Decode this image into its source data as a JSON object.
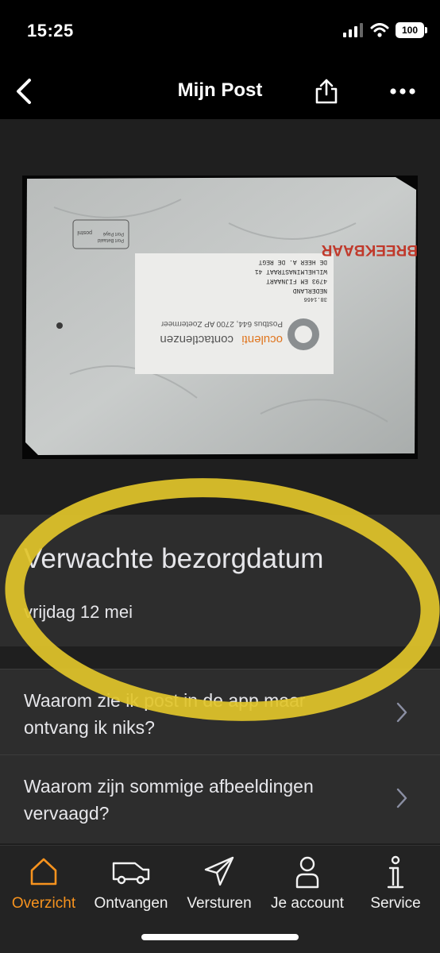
{
  "status_bar": {
    "time": "15:25",
    "battery": "100"
  },
  "nav": {
    "title": "Mijn Post"
  },
  "envelope": {
    "sender_brand": "oculenti",
    "sender_brand_suffix": "contactlenzen",
    "sender_address": "Postbus 644, 2700 AP Zoetermeer",
    "recipient_lines": [
      "DE HEER A. DE REGT",
      "WILHELMINASTRAAT 41",
      "4793 EM FIJNAART",
      "NEDERLAND"
    ],
    "code": "38.1466",
    "fragile_label": "BREEKBAAR",
    "postage_label": "Port Betaald",
    "postage_label_2": "Port Payé",
    "postnl_label": "postnl"
  },
  "delivery": {
    "heading": "Verwachte bezorgdatum",
    "date": "vrijdag 12 mei"
  },
  "faq": [
    {
      "question": "Waarom zie ik post in de app maar ontvang ik niks?"
    },
    {
      "question": "Waarom zijn sommige afbeeldingen vervaagd?"
    }
  ],
  "tabs": [
    {
      "label": "Overzicht",
      "icon": "home-icon",
      "active": true
    },
    {
      "label": "Ontvangen",
      "icon": "van-icon",
      "active": false
    },
    {
      "label": "Versturen",
      "icon": "send-icon",
      "active": false
    },
    {
      "label": "Je account",
      "icon": "person-icon",
      "active": false
    },
    {
      "label": "Service",
      "icon": "info-icon",
      "active": false
    }
  ],
  "colors": {
    "accent": "#f7931e",
    "highlight_ring": "#e2c62a",
    "background": "#1f1f1f",
    "card": "#2d2d2d"
  }
}
